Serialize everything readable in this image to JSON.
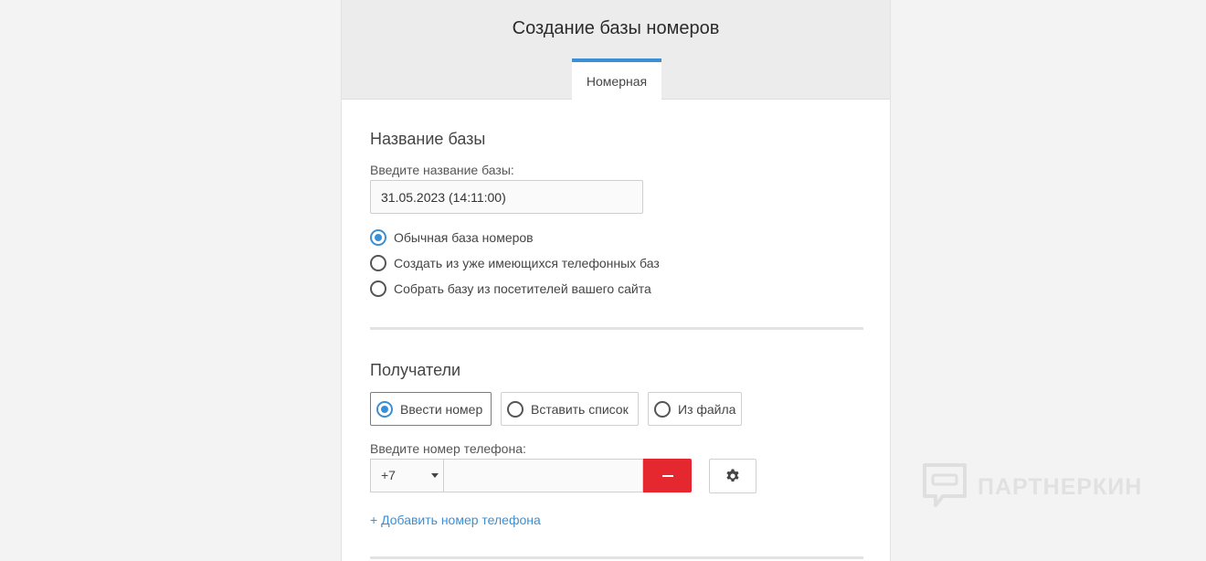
{
  "header": {
    "title": "Создание базы номеров",
    "tab_label": "Номерная"
  },
  "base_section": {
    "title": "Название базы",
    "input_label": "Введите название базы:",
    "input_value": "31.05.2023 (14:11:00)",
    "options": [
      {
        "label": "Обычная база номеров",
        "checked": true
      },
      {
        "label": "Создать из уже имеющихся телефонных баз",
        "checked": false
      },
      {
        "label": "Собрать базу из посетителей вашего сайта",
        "checked": false
      }
    ]
  },
  "recipients_section": {
    "title": "Получатели",
    "modes": [
      {
        "label": "Ввести номер",
        "active": true
      },
      {
        "label": "Вставить список",
        "active": false
      },
      {
        "label": "Из файла",
        "active": false
      }
    ],
    "phone_label": "Введите номер телефона:",
    "country_code": "+7",
    "phone_value": "",
    "add_link": "+ Добавить номер телефона"
  },
  "watermark": {
    "text": "ПАРТНЕРКИН"
  },
  "colors": {
    "accent": "#3d8fd4",
    "danger": "#e5282f",
    "header_bg": "#ececec"
  }
}
